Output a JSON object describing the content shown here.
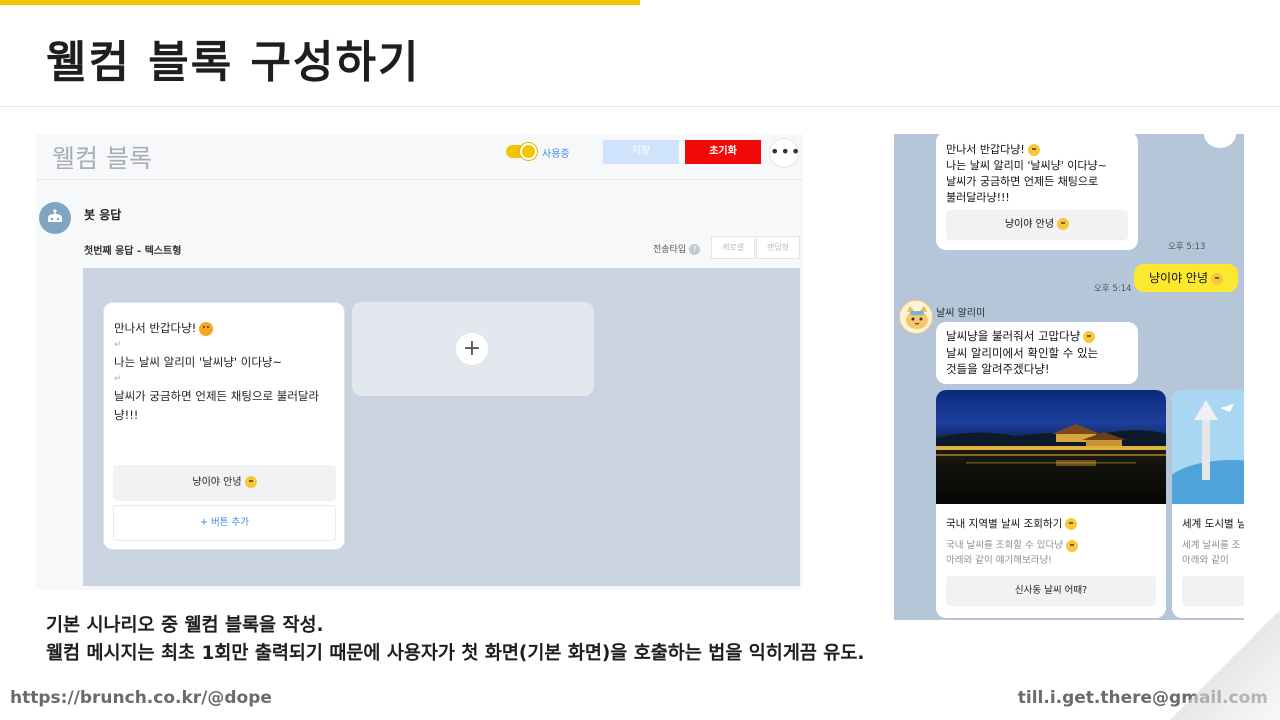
{
  "slide": {
    "title": "웰컴 블록 구성하기",
    "caption_line1": "기본 시나리오 중 웰컴 블록을 작성.",
    "caption_line2": "웰컴 메시지는 최초 1회만 출력되기 때문에 사용자가 첫 화면(기본 화면)을 호출하는 법을 익히게끔 유도.",
    "footer_left": "https://brunch.co.kr/@dope",
    "footer_right": "till.i.get.there@gmail.com",
    "accent_color": "#f5c400"
  },
  "editor": {
    "block_title": "웰컴 블록",
    "toggle_label": "사용중",
    "save_label": "저장",
    "reset_label": "초기화",
    "more_label": "•••",
    "bot_response_label": "봇 응답",
    "response_type_label": "첫번째 응답 - 텍스트형",
    "send_type_label": "전송타입",
    "send_type_options": [
      "케로셀",
      "랜덤형"
    ],
    "card": {
      "line1": "만나서 반갑다냥!",
      "line2": "나는 날씨 알리미 '날씨냥' 이다냥~",
      "line3": "날씨가 궁금하면 언제든 채팅으로 불러달라냥!!!",
      "return_mark": "↵",
      "quick_reply": "냥이야 안녕",
      "add_button": "+ 버튼 추가"
    },
    "add_card_icon": "+",
    "colors": {
      "reset": "#f10808",
      "save": "#cfe3fb",
      "canvas": "#c9d4e0"
    }
  },
  "chat": {
    "welcome_bubble": {
      "line1": "만나서 반갑다냥!",
      "line2": "나는 날씨 알리미 '날씨냥' 이다냥~",
      "line3": "날씨가 궁금하면 언제든 채팅으로",
      "line4": "불러달라냥!!!",
      "quick_reply": "냥이야 안녕"
    },
    "time1": "오후 5:13",
    "user_message": "냥이야 안녕",
    "time2": "오후 5:14",
    "bot_name": "날씨 알리미",
    "reply_bubble": {
      "line1": "날씨냥을 불러줘서 고맙다냥",
      "line2": "날씨 알리미에서 확인할 수 있는",
      "line3": "것들을 알려주겠다냥!"
    },
    "carousel": [
      {
        "title": "국내 지역별 날씨 조회하기",
        "desc1": "국내 날씨를 조회할 수 있다냥",
        "desc2": "아래와 같이 얘기해보라냥!",
        "button": "신사동 날씨 어때?"
      },
      {
        "title": "세계 도시별 날",
        "desc1": "세계 날씨를 조",
        "desc2": "아래와 같이",
        "button": ""
      }
    ],
    "colors": {
      "background": "#b5c6d8",
      "user_bubble": "#fde830"
    }
  }
}
